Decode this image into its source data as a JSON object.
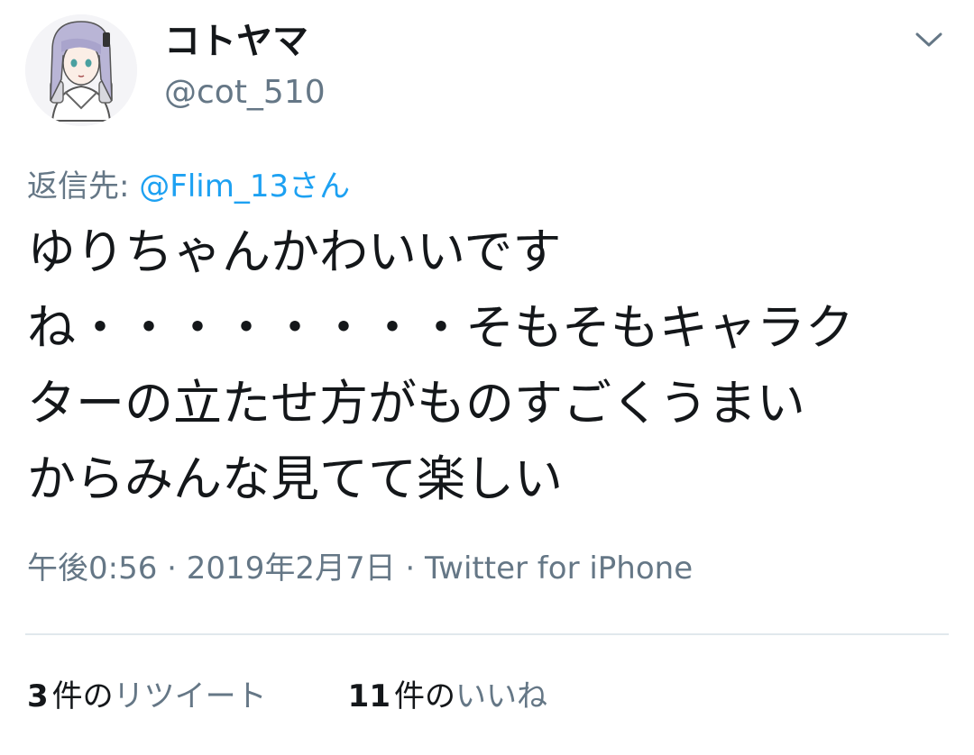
{
  "header": {
    "display_name": "コトヤマ",
    "handle": "@cot_510",
    "avatar_icon": "anime-girl-avatar-icon",
    "menu_icon": "chevron-down-icon"
  },
  "reply": {
    "prefix": "返信先: ",
    "mention": "@Flim_13",
    "suffix": "さん"
  },
  "tweet": {
    "lines": [
      "ゆりちゃんかわいいです",
      "ね・・・・・・・・そもそもキャラク",
      "ターの立たせ方がものすごくうまい",
      "からみんな見てて楽しい"
    ]
  },
  "meta": {
    "time": "午後0:56",
    "sep1": " · ",
    "date": "2019年2月7日",
    "sep2": " · ",
    "source": "Twitter for iPhone"
  },
  "stats": {
    "retweets": {
      "count": "3",
      "unit": "件の",
      "label": "リツイート"
    },
    "likes": {
      "count": "11",
      "unit": "件の",
      "label": "いいね"
    }
  },
  "colors": {
    "text": "#14171a",
    "secondary": "#657786",
    "link": "#1da1f2",
    "divider": "#e1e8ed"
  }
}
